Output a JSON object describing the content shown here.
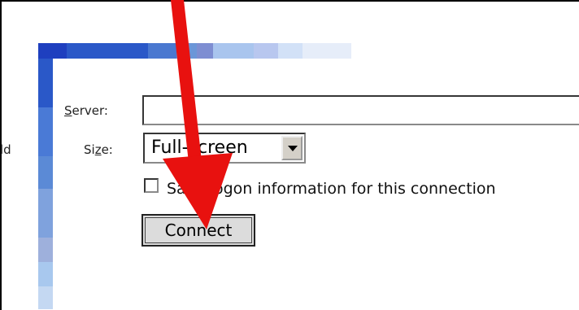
{
  "form": {
    "partial_label": "ld",
    "server": {
      "label_accesskey": "S",
      "label_rest": "erver:",
      "value": ""
    },
    "size": {
      "label_pre": "Si",
      "label_accesskey": "z",
      "label_post": "e:",
      "selected": "Full-screen"
    },
    "save_logon": {
      "checked": false,
      "label": "Save logon information for this connection"
    },
    "connect_label": "Connect"
  },
  "decor": {
    "top_bar_colors": [
      "#1e3fbf",
      "#2a58c8",
      "#4a78d0",
      "#6b96d8",
      "#7e8ed2",
      "#a9c5ee",
      "#b8c7ef",
      "#d2e1f7",
      "#e6edf9"
    ],
    "left_bar_colors": [
      "#2a58c8",
      "#4a7ad6",
      "#5b8ad6",
      "#7fa2dd",
      "#9eb0dc",
      "#a8c8ee",
      "#c4d8f2"
    ],
    "annotation_arrow_color": "#e8110f"
  },
  "icons": {
    "dropdown": "chevron-down-icon",
    "annotation": "red-arrow-icon"
  }
}
